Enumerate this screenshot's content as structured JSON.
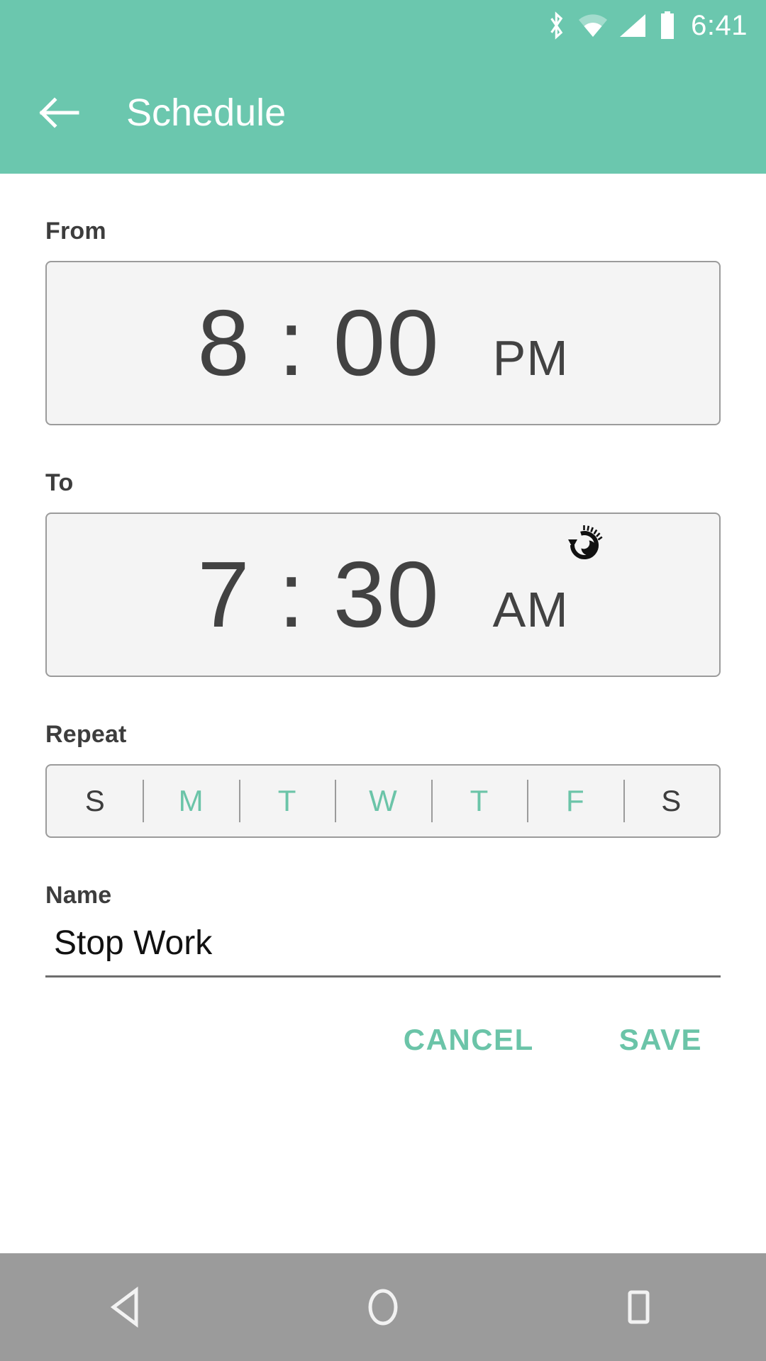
{
  "status_bar": {
    "clock": "6:41",
    "icons": [
      "bluetooth-icon",
      "wifi-icon",
      "cellular-signal-icon",
      "battery-icon"
    ]
  },
  "app_bar": {
    "back_icon": "back-arrow-icon",
    "title": "Schedule"
  },
  "colors": {
    "accent_green": "#6BC7AE",
    "selected_day_green": "#6BC4A8",
    "field_background": "#f4f4f4",
    "field_border": "#9b9b9b",
    "nav_bar_gray": "#9b9b9b"
  },
  "from": {
    "label": "From",
    "time": "8 : 00",
    "meridiem": "PM"
  },
  "to": {
    "label": "To",
    "time": "7 : 30",
    "meridiem": "AM",
    "next_day_icon": "night-next-day-icon"
  },
  "repeat": {
    "label": "Repeat",
    "days": [
      {
        "letter": "S",
        "name": "sunday",
        "selected": false
      },
      {
        "letter": "M",
        "name": "monday",
        "selected": true
      },
      {
        "letter": "T",
        "name": "tuesday",
        "selected": true
      },
      {
        "letter": "W",
        "name": "wednesday",
        "selected": true
      },
      {
        "letter": "T",
        "name": "thursday",
        "selected": true
      },
      {
        "letter": "F",
        "name": "friday",
        "selected": true
      },
      {
        "letter": "S",
        "name": "saturday",
        "selected": false
      }
    ]
  },
  "name": {
    "label": "Name",
    "value": "Stop Work",
    "placeholder": "Name"
  },
  "actions": {
    "cancel_label": "CANCEL",
    "save_label": "SAVE"
  },
  "nav_bar": {
    "back": "nav-back-icon",
    "home": "nav-home-icon",
    "recents": "nav-recents-icon"
  }
}
